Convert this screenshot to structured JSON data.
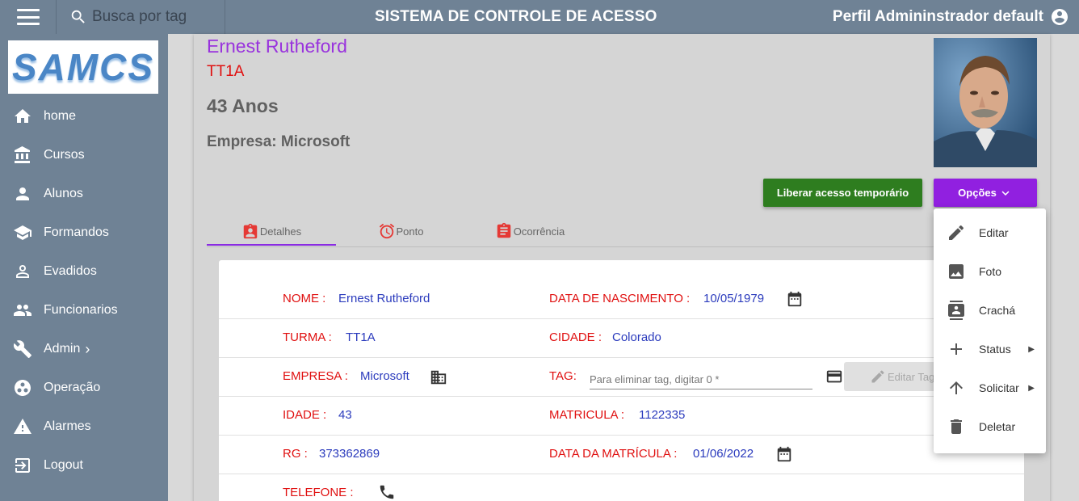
{
  "header": {
    "title": "SISTEMA DE CONTROLE DE ACESSO",
    "search_placeholder": "Busca por tag",
    "profile_label": "Perfil Admininstrador default"
  },
  "logo": {
    "text": "SAMCS"
  },
  "sidebar": {
    "items": [
      {
        "label": "home",
        "icon": "home-icon"
      },
      {
        "label": "Cursos",
        "icon": "bank-icon"
      },
      {
        "label": "Alunos",
        "icon": "person-icon"
      },
      {
        "label": "Formandos",
        "icon": "school-icon"
      },
      {
        "label": "Evadidos",
        "icon": "person-outline-icon"
      },
      {
        "label": "Funcionarios",
        "icon": "people-icon"
      },
      {
        "label": "Admin",
        "icon": "wrench-icon",
        "has_submenu": true
      },
      {
        "label": "Operação",
        "icon": "operation-icon"
      },
      {
        "label": "Alarmes",
        "icon": "warning-icon"
      },
      {
        "label": "Logout",
        "icon": "logout-icon"
      }
    ]
  },
  "profile": {
    "name": "Ernest Rutheford",
    "class": "TT1A",
    "age": "43 Anos",
    "company": "Empresa: Microsoft"
  },
  "actions": {
    "temp_access": "Liberar acesso temporário",
    "options": "Opções"
  },
  "tabs": [
    {
      "label": "Detalhes",
      "icon": "badge-icon",
      "active": true
    },
    {
      "label": "Ponto",
      "icon": "alarm-icon",
      "active": false
    },
    {
      "label": "Ocorrência",
      "icon": "clipboard-icon",
      "active": false
    }
  ],
  "details": {
    "nome_label": "NOME :",
    "nome_value": "Ernest Rutheford",
    "nascimento_label": "DATA DE NASCIMENTO :",
    "nascimento_value": "10/05/1979",
    "turma_label": "TURMA :",
    "turma_value": "TT1A",
    "cidade_label": "CIDADE :",
    "cidade_value": "Colorado",
    "empresa_label": "EMPRESA :",
    "empresa_value": "Microsoft",
    "tag_label": "TAG:",
    "tag_placeholder": "Para eliminar tag, digitar 0 *",
    "edit_tag_label": "Editar Tag",
    "idade_label": "IDADE :",
    "idade_value": "43",
    "matricula_label": "MATRICULA :",
    "matricula_value": "1122335",
    "rg_label": "RG :",
    "rg_value": "373362869",
    "data_matricula_label": "DATA DA MATRÍCULA :",
    "data_matricula_value": "01/06/2022",
    "telefone_label": "TELEFONE :"
  },
  "options_menu": [
    {
      "label": "Editar",
      "icon": "pencil-icon"
    },
    {
      "label": "Foto",
      "icon": "image-icon"
    },
    {
      "label": "Crachá",
      "icon": "id-badge-icon"
    },
    {
      "label": "Status",
      "icon": "plus-icon",
      "has_submenu": true
    },
    {
      "label": "Solicitar",
      "icon": "arrow-up-icon",
      "has_submenu": true
    },
    {
      "label": "Deletar",
      "icon": "trash-icon"
    }
  ],
  "colors": {
    "bar": "#6f8295",
    "name": "#9933dd",
    "label": "#e01010",
    "value": "#2b3bbd",
    "temp_button": "#2e7d1f",
    "options_button": "#9120e0"
  }
}
